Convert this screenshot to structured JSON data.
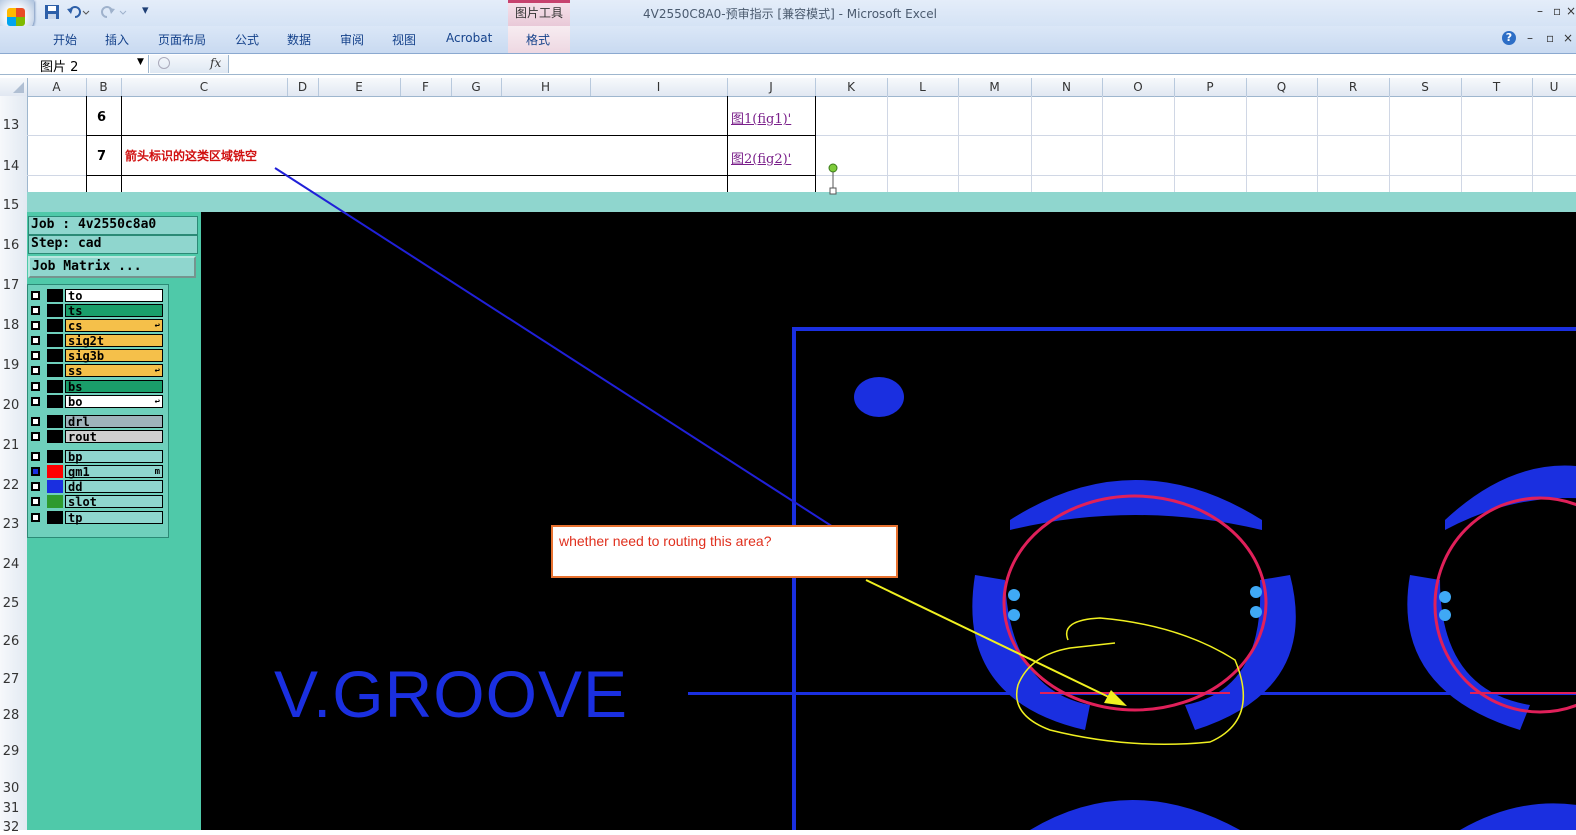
{
  "window": {
    "title": "4V2550C8A0-预审指示  [兼容模式] - Microsoft Excel",
    "context_tab": "图片工具",
    "min_glyph": "–",
    "restore_glyph": "▫",
    "close_glyph": "×",
    "qat_more": "▾"
  },
  "ribbon": {
    "tabs": [
      "开始",
      "插入",
      "页面布局",
      "公式",
      "数据",
      "审阅",
      "视图",
      "Acrobat",
      "格式"
    ],
    "help": "?",
    "win_min": "–",
    "win_restore": "▫",
    "win_close": "×"
  },
  "formula_bar": {
    "name_box": "图片 2",
    "fx": "fx",
    "formula": ""
  },
  "columns": [
    "A",
    "B",
    "C",
    "D",
    "E",
    "F",
    "G",
    "H",
    "I",
    "J",
    "K",
    "L",
    "M",
    "N",
    "O",
    "P",
    "Q",
    "R",
    "S",
    "T",
    "U"
  ],
  "rows": [
    "13",
    "14",
    "15",
    "16",
    "17",
    "18",
    "19",
    "20",
    "21",
    "22",
    "23",
    "24",
    "25",
    "26",
    "27",
    "28",
    "29",
    "30",
    "31",
    "32"
  ],
  "cells": {
    "b13": "6",
    "j13": "图1(fig1)'",
    "b14": "7",
    "c14": "箭头标识的这类区域铣空",
    "j14": "图2(fig2)'"
  },
  "cam": {
    "job": "Job : 4v2550c8a0",
    "step": "Step: cad",
    "matrix_button": "Job Matrix ...",
    "layers": [
      {
        "name": "to",
        "color": "#ffffff",
        "swatch": "#000000",
        "mark": ""
      },
      {
        "name": "ts",
        "color": "#1a9e6a",
        "swatch": "#000000",
        "mark": ""
      },
      {
        "name": "cs",
        "color": "#f5c04a",
        "swatch": "#000000",
        "mark": "↩"
      },
      {
        "name": "sig2t",
        "color": "#f5c04a",
        "swatch": "#000000",
        "mark": ""
      },
      {
        "name": "sig3b",
        "color": "#f5c04a",
        "swatch": "#000000",
        "mark": ""
      },
      {
        "name": "ss",
        "color": "#f5c04a",
        "swatch": "#000000",
        "mark": "↩"
      },
      {
        "name": "bs",
        "color": "#1a9e6a",
        "swatch": "#000000",
        "mark": ""
      },
      {
        "name": "bo",
        "color": "#ffffff",
        "swatch": "#000000",
        "mark": "↩"
      },
      {
        "name": "drl",
        "color": "#9fb3bb",
        "swatch": "#000000",
        "mark": ""
      },
      {
        "name": "rout",
        "color": "#d0d0d0",
        "swatch": "#000000",
        "mark": ""
      },
      {
        "name": "bp",
        "color": "#8fd6ce",
        "swatch": "#000000",
        "mark": ""
      },
      {
        "name": "gm1",
        "color": "#8fd6ce",
        "swatch": "#ff0000",
        "mark": "m"
      },
      {
        "name": "dd",
        "color": "#8fd6ce",
        "swatch": "#1a2fe0",
        "mark": ""
      },
      {
        "name": "slot",
        "color": "#8fd6ce",
        "swatch": "#2e9a2e",
        "mark": ""
      },
      {
        "name": "tp",
        "color": "#8fd6ce",
        "swatch": "#000000",
        "mark": ""
      }
    ],
    "callout": "whether need to routing this area?",
    "vgroove": "V.GROOVE"
  },
  "colors": {
    "board": "#1a2fe0",
    "outline": "#e0205a",
    "annotation_arrow": "#2020d8",
    "yellow": "#f0f020",
    "callout_border": "#e87230",
    "callout_text": "#e0301e",
    "cell_red": "#d01010",
    "link": "#7a1f8a"
  }
}
